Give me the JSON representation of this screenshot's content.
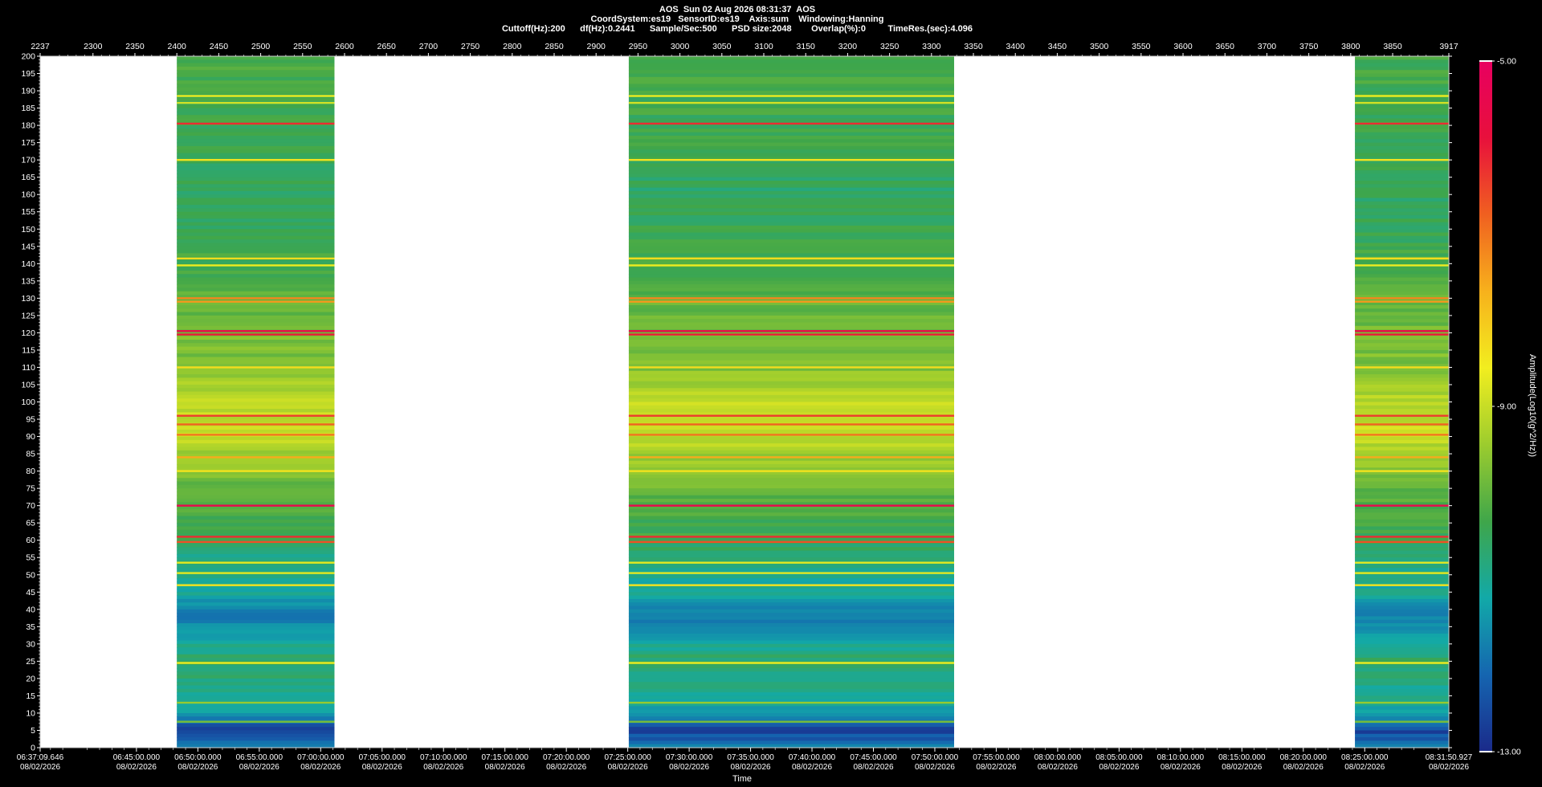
{
  "header": {
    "line1": "AOS  Sun 02 Aug 2026 08:31:37  AOS",
    "line2": "CoordSystem:es19   SensorID:es19    Axis:sum    Windowing:Hanning",
    "line3": "Cuttoff(Hz):200      df(Hz):0.2441      Sample/Sec:500      PSD size:2048        Overlap(%):0         TimeRes.(sec):4.096"
  },
  "colors": {
    "background": "#000000",
    "gap": "#ffffff",
    "axis": "#ffffff"
  },
  "colorbar": {
    "label": "Amplitude(Log10(g^2/Hz))",
    "ticks": [
      "-5.00",
      "-9.00",
      "-13.00"
    ],
    "range": [
      -13,
      -5
    ],
    "stops": [
      "#1a2a8a",
      "#1565b0",
      "#12a9a8",
      "#3fa64a",
      "#9ccc2e",
      "#f2ee1f",
      "#f7b11c",
      "#f06020",
      "#e8103c",
      "#e80060"
    ]
  },
  "chart_data": {
    "type": "heatmap",
    "xlabel": "Time",
    "ylabel": "",
    "top_axis": {
      "range": [
        2237,
        3917
      ],
      "tick_labels": [
        "2237",
        "2300",
        "2350",
        "2400",
        "2450",
        "2500",
        "2550",
        "2600",
        "2650",
        "2700",
        "2750",
        "2800",
        "2850",
        "2900",
        "2950",
        "3000",
        "3050",
        "3100",
        "3150",
        "3200",
        "3250",
        "3300",
        "3350",
        "3400",
        "3450",
        "3500",
        "3550",
        "3600",
        "3650",
        "3700",
        "3750",
        "3800",
        "3850",
        "3917"
      ]
    },
    "ylim": [
      0,
      200
    ],
    "y_tick_labels": [
      "200",
      "195",
      "190",
      "185",
      "180",
      "175",
      "170",
      "165",
      "160",
      "155",
      "150",
      "145",
      "140",
      "135",
      "130",
      "125",
      "120",
      "115",
      "110",
      "105",
      "100",
      "95",
      "90",
      "85",
      "80",
      "75",
      "70",
      "65",
      "60",
      "55",
      "50",
      "45",
      "40",
      "35",
      "30",
      "25",
      "20",
      "15",
      "10",
      "5",
      "0"
    ],
    "x_tick_times": [
      "06:37:09.646",
      "06:45:00.000",
      "06:50:00.000",
      "06:55:00.000",
      "07:00:00.000",
      "07:05:00.000",
      "07:10:00.000",
      "07:15:00.000",
      "07:20:00.000",
      "07:25:00.000",
      "07:30:00.000",
      "07:35:00.000",
      "07:40:00.000",
      "07:45:00.000",
      "07:50:00.000",
      "07:55:00.000",
      "08:00:00.000",
      "08:05:00.000",
      "08:10:00.000",
      "08:15:00.000",
      "08:20:00.000",
      "08:25:00.000",
      "08:31:50.927"
    ],
    "x_tick_date": "08/02/2026",
    "data_segments": [
      {
        "start": 2400,
        "end": 2588
      },
      {
        "start": 2939,
        "end": 3327
      },
      {
        "start": 3805,
        "end": 3917
      }
    ],
    "tone_lines_hz": [
      {
        "hz": 188.5,
        "level": -8.6
      },
      {
        "hz": 186.5,
        "level": -8.9
      },
      {
        "hz": 180.5,
        "level": -6.2
      },
      {
        "hz": 170.0,
        "level": -8.4
      },
      {
        "hz": 141.5,
        "level": -8.3
      },
      {
        "hz": 139.5,
        "level": -8.6
      },
      {
        "hz": 130.0,
        "level": -7.2
      },
      {
        "hz": 129.0,
        "level": -7.4
      },
      {
        "hz": 120.5,
        "level": -5.6
      },
      {
        "hz": 119.5,
        "level": -6.0
      },
      {
        "hz": 110.0,
        "level": -8.3
      },
      {
        "hz": 96.0,
        "level": -6.4
      },
      {
        "hz": 93.5,
        "level": -6.8
      },
      {
        "hz": 90.5,
        "level": -7.0
      },
      {
        "hz": 84.0,
        "level": -7.6
      },
      {
        "hz": 80.0,
        "level": -8.4
      },
      {
        "hz": 70.0,
        "level": -5.5
      },
      {
        "hz": 61.0,
        "level": -6.2
      },
      {
        "hz": 59.5,
        "level": -6.6
      },
      {
        "hz": 53.5,
        "level": -8.7
      },
      {
        "hz": 50.5,
        "level": -8.7
      },
      {
        "hz": 47.0,
        "level": -8.4
      },
      {
        "hz": 24.5,
        "level": -8.6
      },
      {
        "hz": 13.0,
        "level": -9.5
      },
      {
        "hz": 7.5,
        "level": -9.8
      }
    ],
    "background_profile": [
      {
        "hz": 200,
        "level": -10.3
      },
      {
        "hz": 180,
        "level": -10.4
      },
      {
        "hz": 160,
        "level": -10.6
      },
      {
        "hz": 140,
        "level": -10.3
      },
      {
        "hz": 125,
        "level": -9.9
      },
      {
        "hz": 110,
        "level": -9.7
      },
      {
        "hz": 100,
        "level": -9.1
      },
      {
        "hz": 90,
        "level": -9.0
      },
      {
        "hz": 80,
        "level": -9.7
      },
      {
        "hz": 70,
        "level": -10.2
      },
      {
        "hz": 60,
        "level": -10.4
      },
      {
        "hz": 55,
        "level": -10.9
      },
      {
        "hz": 45,
        "level": -11.1
      },
      {
        "hz": 38,
        "level": -11.8
      },
      {
        "hz": 32,
        "level": -11.3
      },
      {
        "hz": 25,
        "level": -10.6
      },
      {
        "hz": 18,
        "level": -10.9
      },
      {
        "hz": 10,
        "level": -11.3
      },
      {
        "hz": 5,
        "level": -12.6
      },
      {
        "hz": 0,
        "level": -11.8
      }
    ]
  }
}
